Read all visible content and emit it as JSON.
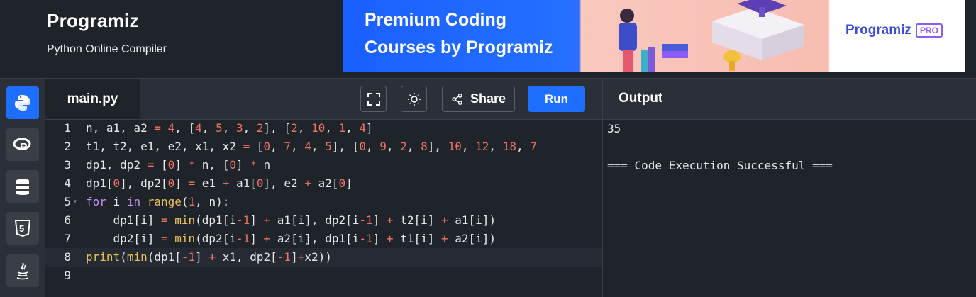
{
  "header": {
    "logo_text": "Programiz",
    "subtitle": "Python Online Compiler"
  },
  "banner": {
    "line1": "Premium Coding",
    "line2": "Courses by Programiz",
    "pro_logo": "Programiz",
    "pro_badge": "PRO"
  },
  "sidebar": {
    "items": [
      {
        "icon": "python-icon",
        "active": true
      },
      {
        "icon": "r-language-icon",
        "active": false
      },
      {
        "icon": "database-icon",
        "active": false
      },
      {
        "icon": "html5-icon",
        "active": false
      },
      {
        "icon": "java-icon",
        "active": false
      }
    ]
  },
  "editor": {
    "tab_label": "main.py",
    "share_label": "Share",
    "run_label": "Run",
    "lines": [
      {
        "n": "1",
        "text": "n, a1, a2 = 4, [4, 5, 3, 2], [2, 10, 1, 4]"
      },
      {
        "n": "2",
        "text": "t1, t2, e1, e2, x1, x2 = [0, 7, 4, 5], [0, 9, 2, 8], 10, 12, 18, 7"
      },
      {
        "n": "3",
        "text": "dp1, dp2 = [0] * n, [0] * n"
      },
      {
        "n": "4",
        "text": "dp1[0], dp2[0] = e1 + a1[0], e2 + a2[0]"
      },
      {
        "n": "5",
        "text": "for i in range(1, n):"
      },
      {
        "n": "6",
        "text": "    dp1[i] = min(dp1[i-1] + a1[i], dp2[i-1] + t2[i] + a1[i])"
      },
      {
        "n": "7",
        "text": "    dp2[i] = min(dp2[i-1] + a2[i], dp1[i-1] + t1[i] + a2[i])"
      },
      {
        "n": "8",
        "text": "print(min(dp1[-1] + x1, dp2[-1]+x2))"
      },
      {
        "n": "9",
        "text": ""
      }
    ]
  },
  "output": {
    "title": "Output",
    "lines": [
      "35",
      "",
      "=== Code Execution Successful ==="
    ]
  }
}
